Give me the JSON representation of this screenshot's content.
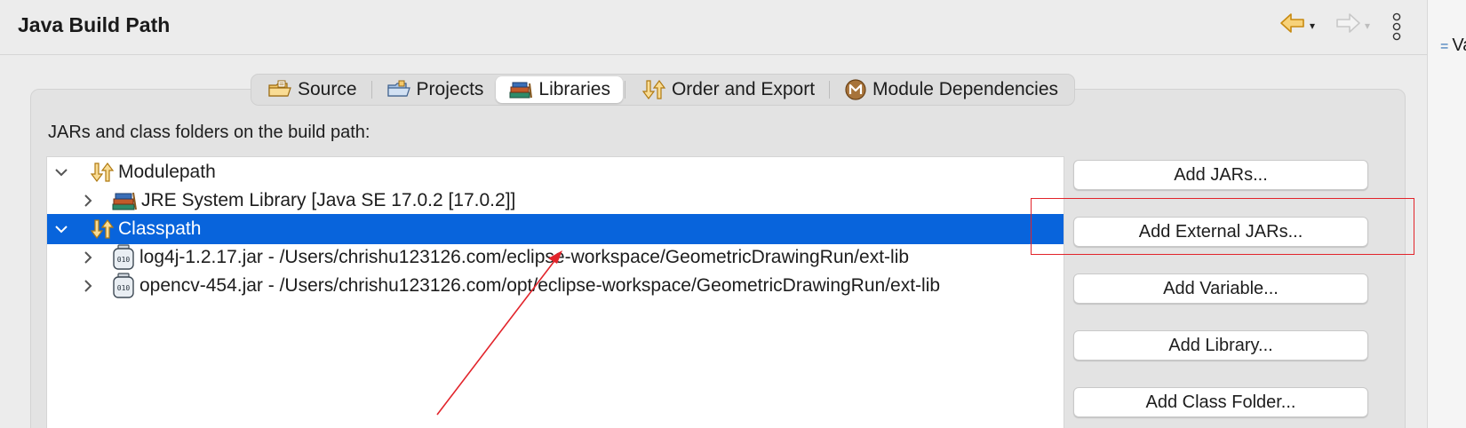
{
  "dialog": {
    "title": "Java Build Path"
  },
  "header": {
    "back_dropdown": "▾",
    "forward_dropdown": "▾"
  },
  "right_strip": {
    "text": "Va"
  },
  "tabs": [
    {
      "label": "Source",
      "icon": "source-folder-icon",
      "active": false
    },
    {
      "label": "Projects",
      "icon": "projects-folder-icon",
      "active": false
    },
    {
      "label": "Libraries",
      "icon": "libraries-icon",
      "active": true
    },
    {
      "label": "Order and Export",
      "icon": "order-export-icon",
      "active": false
    },
    {
      "label": "Module Dependencies",
      "icon": "module-icon",
      "active": false
    }
  ],
  "section_label": "JARs and class folders on the build path:",
  "tree": {
    "items": [
      {
        "label": "Modulepath",
        "icon": "modulepath-icon",
        "expanded": true,
        "level": 0
      },
      {
        "label": "JRE System Library [Java SE 17.0.2 [17.0.2]]",
        "icon": "jre-library-icon",
        "expanded": false,
        "level": 1
      },
      {
        "label": "Classpath",
        "icon": "classpath-icon",
        "expanded": true,
        "level": 0,
        "selected": true
      },
      {
        "label": "log4j-1.2.17.jar - /Users/chrishu123126.com/eclipse-workspace/GeometricDrawingRun/ext-lib",
        "icon": "jar-icon",
        "expanded": false,
        "level": 1
      },
      {
        "label": "opencv-454.jar - /Users/chrishu123126.com/opt/eclipse-workspace/GeometricDrawingRun/ext-lib",
        "icon": "jar-icon",
        "expanded": false,
        "level": 1
      }
    ]
  },
  "buttons": [
    {
      "label": "Add JARs..."
    },
    {
      "label": "Add External JARs..."
    },
    {
      "label": "Add Variable..."
    },
    {
      "label": "Add Library..."
    },
    {
      "label": "Add Class Folder..."
    }
  ],
  "colors": {
    "selection": "#0864dc",
    "annotation": "#e2242b"
  }
}
